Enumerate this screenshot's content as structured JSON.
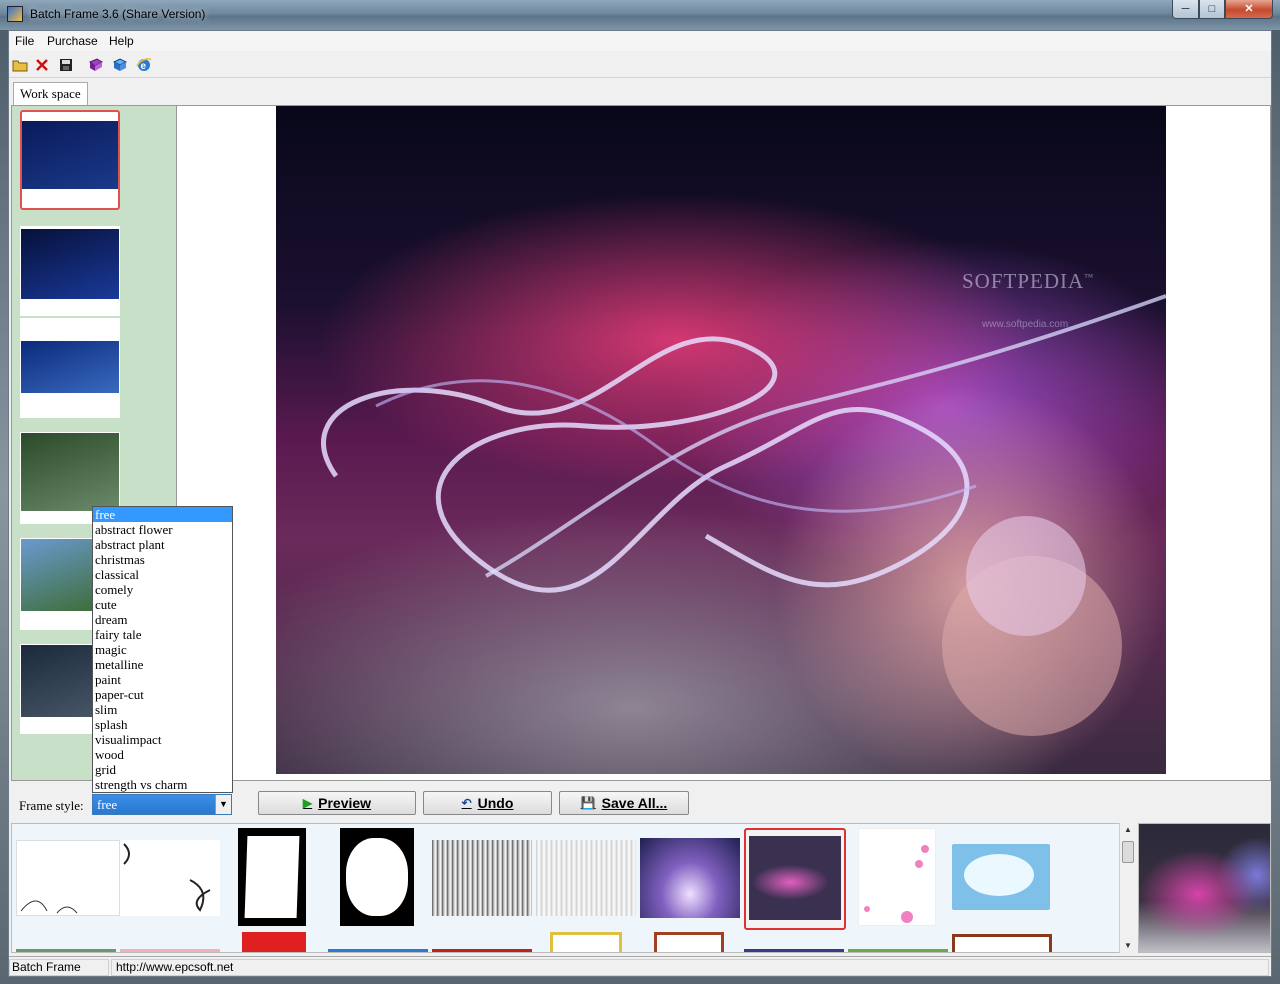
{
  "window": {
    "title": "Batch Frame 3.6 (Share Version)",
    "min_glyph": "─",
    "max_glyph": "□",
    "close_glyph": "✕"
  },
  "menu": [
    "File",
    "Purchase",
    "Help"
  ],
  "toolbar": [
    "open-folder-icon",
    "delete-icon",
    "save-icon",
    "book-icon",
    "box-icon",
    "ie-icon"
  ],
  "tabs": [
    "Work space"
  ],
  "main_image": {
    "watermark": "SOFTPEDIA",
    "watermark_tm": "™",
    "watermark_url": "www.softpedia.com"
  },
  "thumbnails": [
    {
      "name": "thumb-1",
      "colors": [
        "#0a1a5a",
        "#1a3a8a"
      ],
      "selected": true
    },
    {
      "name": "thumb-2",
      "colors": [
        "#06103a",
        "#1a3a9a"
      ],
      "selected": false
    },
    {
      "name": "thumb-3",
      "colors": [
        "#0a2a7a",
        "#3a6ac0"
      ],
      "selected": false
    },
    {
      "name": "thumb-4",
      "colors": [
        "#2a4a2a",
        "#6a8a6a"
      ],
      "selected": false
    },
    {
      "name": "thumb-5",
      "colors": [
        "#6a9ad0",
        "#3a6a2a"
      ],
      "selected": false
    },
    {
      "name": "thumb-6",
      "colors": [
        "#1a2a3a",
        "#4a5a6a"
      ],
      "selected": false
    }
  ],
  "frame_style": {
    "label": "Frame style:",
    "selected": "free",
    "arrow": "▼",
    "options": [
      "free",
      "abstract flower",
      "abstract plant",
      "christmas",
      "classical",
      "comely",
      "cute",
      "dream",
      "fairy tale",
      "magic",
      "metalline",
      "paint",
      "paper-cut",
      "slim",
      "splash",
      "visualimpact",
      "wood",
      "grid",
      "strength vs charm"
    ]
  },
  "buttons": {
    "preview": "Preview",
    "preview_icon": "▶",
    "undo": "Undo",
    "undo_icon": "↶",
    "save_all": "Save All...",
    "save_all_icon": "💾"
  },
  "scrollbar": {
    "up": "▲",
    "down": "▼"
  },
  "status": {
    "left": "Batch Frame",
    "right": "http://www.epcsoft.net"
  }
}
